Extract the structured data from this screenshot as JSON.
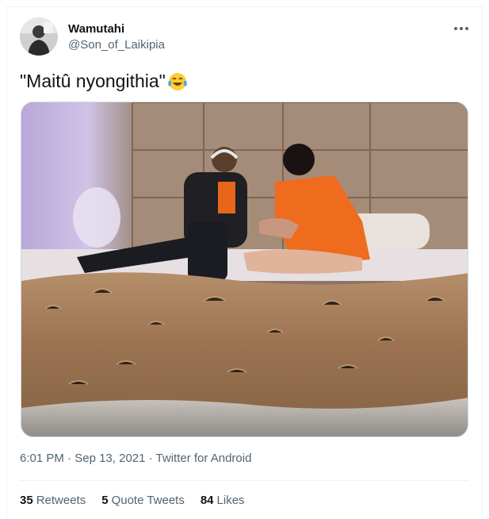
{
  "author": {
    "display_name": "Wamutahi",
    "handle": "@Son_of_Laikipia"
  },
  "tweet": {
    "text": "\"Maitû nyongithia\"",
    "emoji": "face-with-tears-of-joy"
  },
  "meta": {
    "time": "6:01 PM",
    "separator1": " · ",
    "date": "Sep 13, 2021",
    "separator2": " · ",
    "source": "Twitter for Android"
  },
  "stats": [
    {
      "count": "35",
      "label": "Retweets"
    },
    {
      "count": "5",
      "label": "Quote Tweets"
    },
    {
      "count": "84",
      "label": "Likes"
    }
  ],
  "icons": {
    "more": "more-horizontal-icon"
  },
  "colors": {
    "text": "#0f1419",
    "muted": "#536471",
    "border": "#eff3f4"
  }
}
